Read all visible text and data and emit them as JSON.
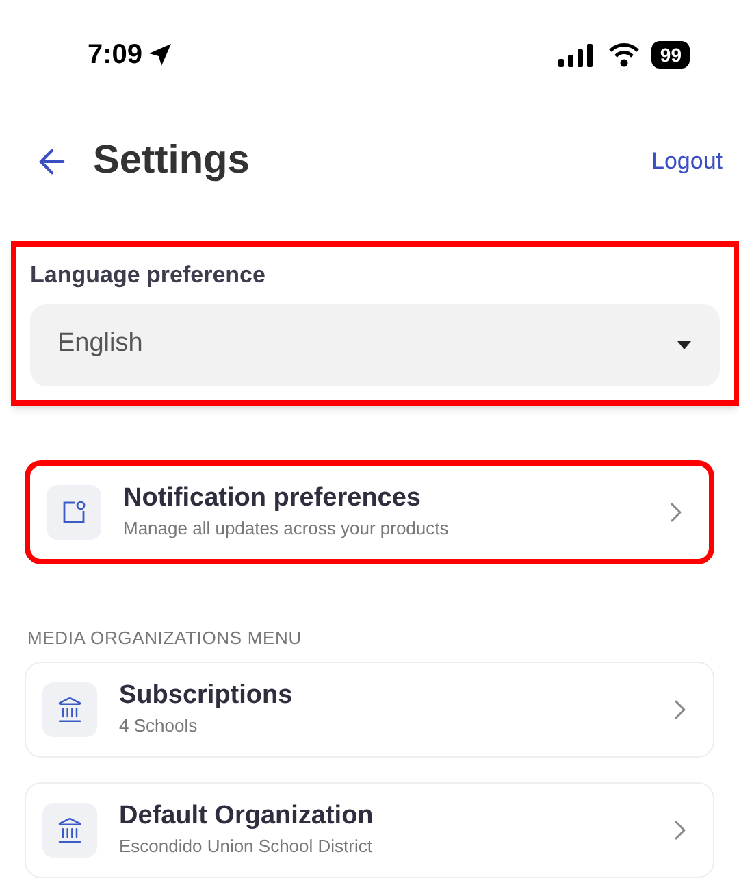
{
  "status_bar": {
    "time": "7:09",
    "battery": "99"
  },
  "header": {
    "title": "Settings",
    "action": "Logout"
  },
  "language": {
    "label": "Language preference",
    "value": "English",
    "highlighted": true
  },
  "notifications": {
    "title": "Notification preferences",
    "subtitle": "Manage all updates across your products",
    "highlighted": true
  },
  "section": {
    "heading": "MEDIA ORGANIZATIONS MENU",
    "items": [
      {
        "title": "Subscriptions",
        "subtitle": "4 Schools"
      },
      {
        "title": "Default Organization",
        "subtitle": "Escondido Union School District"
      }
    ]
  }
}
